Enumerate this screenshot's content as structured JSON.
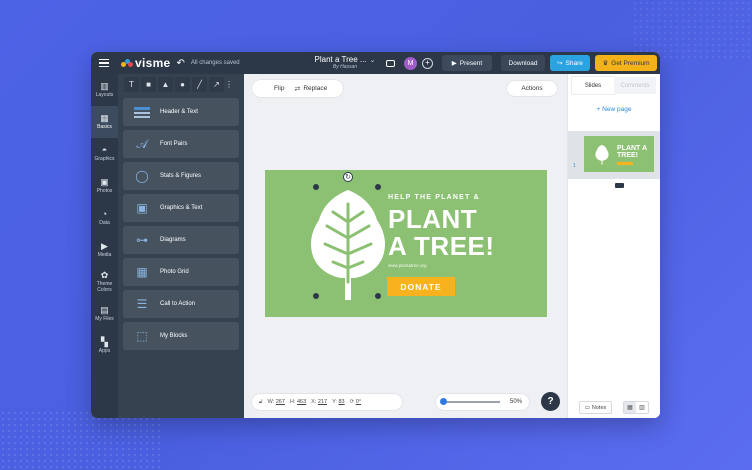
{
  "topbar": {
    "logo": "visme",
    "saved_status": "All changes saved",
    "doc_title": "Plant a Tree ...",
    "doc_author": "By Hassan",
    "avatar_initial": "M",
    "present_label": "Present",
    "download_label": "Download",
    "share_label": "Share",
    "premium_label": "Get Premium"
  },
  "rail": [
    {
      "label": "Layouts",
      "icon": "layouts-icon",
      "glyph": "▥"
    },
    {
      "label": "Basics",
      "icon": "basics-icon",
      "glyph": "▦"
    },
    {
      "label": "Graphics",
      "icon": "graphics-icon",
      "glyph": "◓"
    },
    {
      "label": "Photos",
      "icon": "photos-icon",
      "glyph": "▣"
    },
    {
      "label": "Data",
      "icon": "data-icon",
      "glyph": "◔"
    },
    {
      "label": "Media",
      "icon": "media-icon",
      "glyph": "▶"
    },
    {
      "label": "Theme Colors",
      "icon": "palette-icon",
      "glyph": "✿"
    },
    {
      "label": "My Files",
      "icon": "folder-icon",
      "glyph": "▤"
    },
    {
      "label": "Apps",
      "icon": "apps-icon",
      "glyph": "▚"
    }
  ],
  "tools": [
    {
      "glyph": "T",
      "icon": "text-tool-icon"
    },
    {
      "glyph": "■",
      "icon": "square-tool-icon"
    },
    {
      "glyph": "▲",
      "icon": "triangle-tool-icon"
    },
    {
      "glyph": "●",
      "icon": "circle-tool-icon"
    },
    {
      "glyph": "╱",
      "icon": "line-tool-icon"
    },
    {
      "glyph": "↗",
      "icon": "arrow-tool-icon"
    }
  ],
  "blocks": [
    {
      "label": "Header & Text",
      "icon": "header-text-icon"
    },
    {
      "label": "Font Pairs",
      "icon": "font-pairs-icon"
    },
    {
      "label": "Stats & Figures",
      "icon": "stats-icon"
    },
    {
      "label": "Graphics & Text",
      "icon": "graphics-text-icon"
    },
    {
      "label": "Diagrams",
      "icon": "diagram-icon"
    },
    {
      "label": "Photo Grid",
      "icon": "photo-grid-icon"
    },
    {
      "label": "Call to Action",
      "icon": "call-to-action-icon"
    },
    {
      "label": "My Blocks",
      "icon": "my-blocks-icon"
    }
  ],
  "canvas": {
    "flip_label": "Flip",
    "replace_label": "Replace",
    "actions_label": "Actions"
  },
  "slide": {
    "tagline": "HELP THE PLANET &",
    "headline_1": "PLANT",
    "headline_2": "A TREE!",
    "url": "www.plantatree.org",
    "button": "DONATE",
    "bg_color": "#8cc173",
    "accent_color": "#f7b21e"
  },
  "dims": {
    "w_label": "W:",
    "w": "267",
    "h_label": "H:",
    "h": "463",
    "x_label": "X:",
    "x": "217",
    "y_label": "Y:",
    "y": "83",
    "rot": "0°"
  },
  "zoom": {
    "value": "50%",
    "level_percent": 50
  },
  "right": {
    "tab_slides": "Slides",
    "tab_comments": "Comments",
    "new_page": "+ New page",
    "page_number": "1",
    "thumb_title": "PLANT A TREE!",
    "notes": "Notes"
  }
}
